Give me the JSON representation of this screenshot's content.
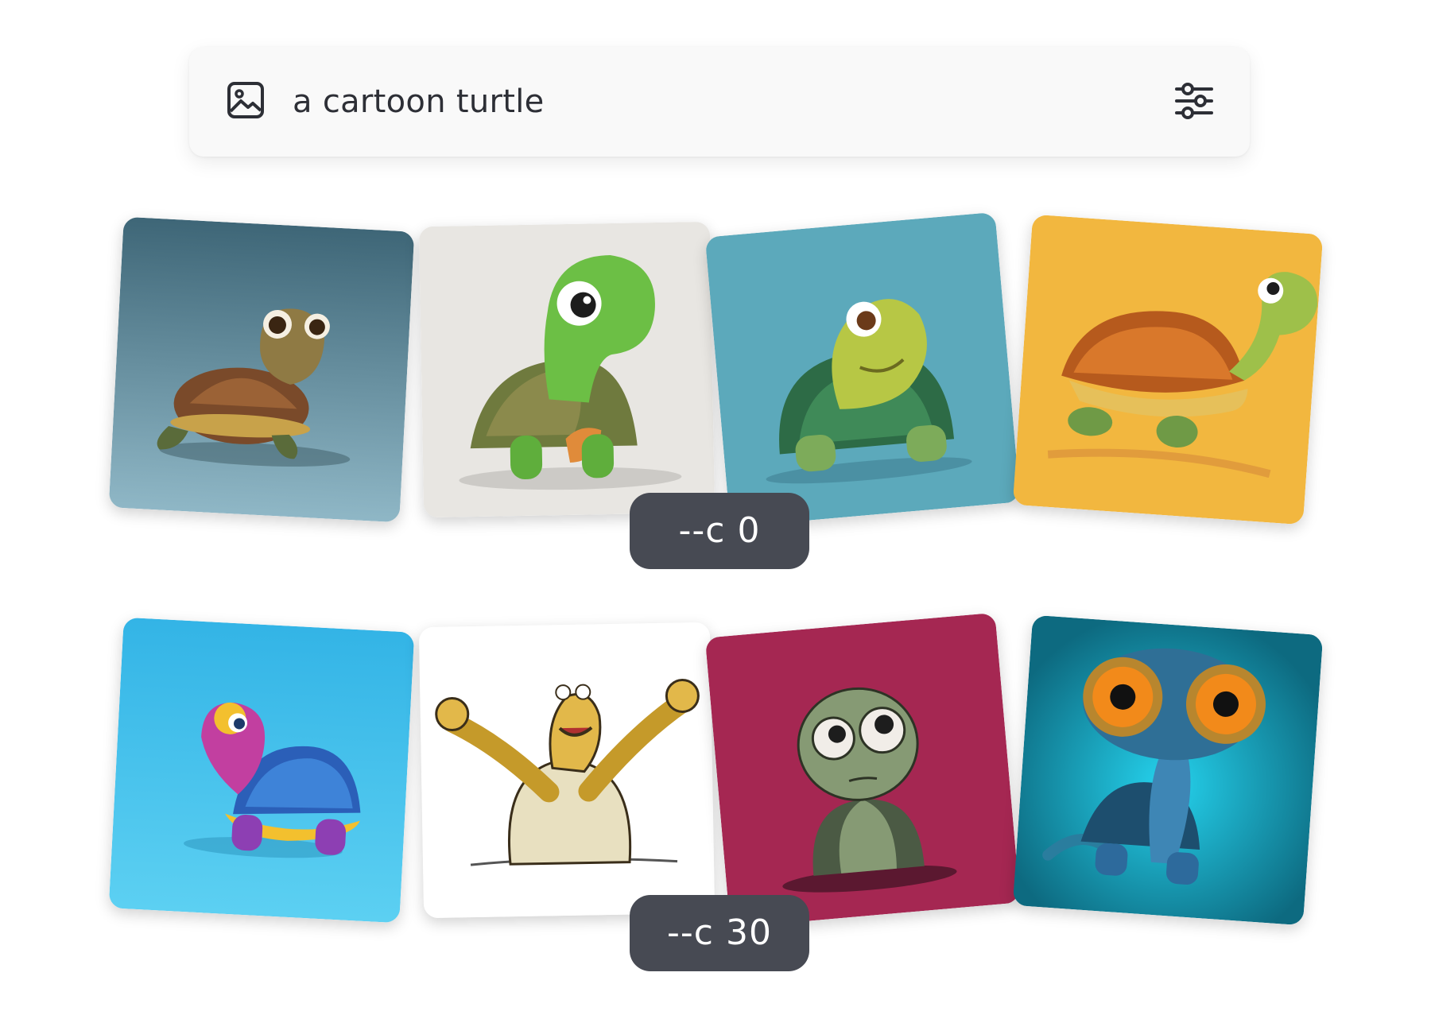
{
  "prompt": {
    "text": "a cartoon turtle",
    "image_icon": "image-icon",
    "settings_icon": "sliders-icon"
  },
  "rows": [
    {
      "badge": "--c 0",
      "images": [
        {
          "subject": "3d sea turtle",
          "background": "#4f7c90"
        },
        {
          "subject": "green plush turtle",
          "background": "#e8e6e2"
        },
        {
          "subject": "cartoon tortoise",
          "background": "#5ca9bb"
        },
        {
          "subject": "drawn turtle running",
          "background": "#f2b73f"
        }
      ]
    },
    {
      "badge": "--c 30",
      "images": [
        {
          "subject": "colorful toy turtle",
          "background": "#3fbde8"
        },
        {
          "subject": "sketch turtle arms raised",
          "background": "#ffffff"
        },
        {
          "subject": "big-eyed turtle on red",
          "background": "#a52752"
        },
        {
          "subject": "turtle with goggles",
          "background": "#1f8fa3"
        }
      ]
    }
  ]
}
